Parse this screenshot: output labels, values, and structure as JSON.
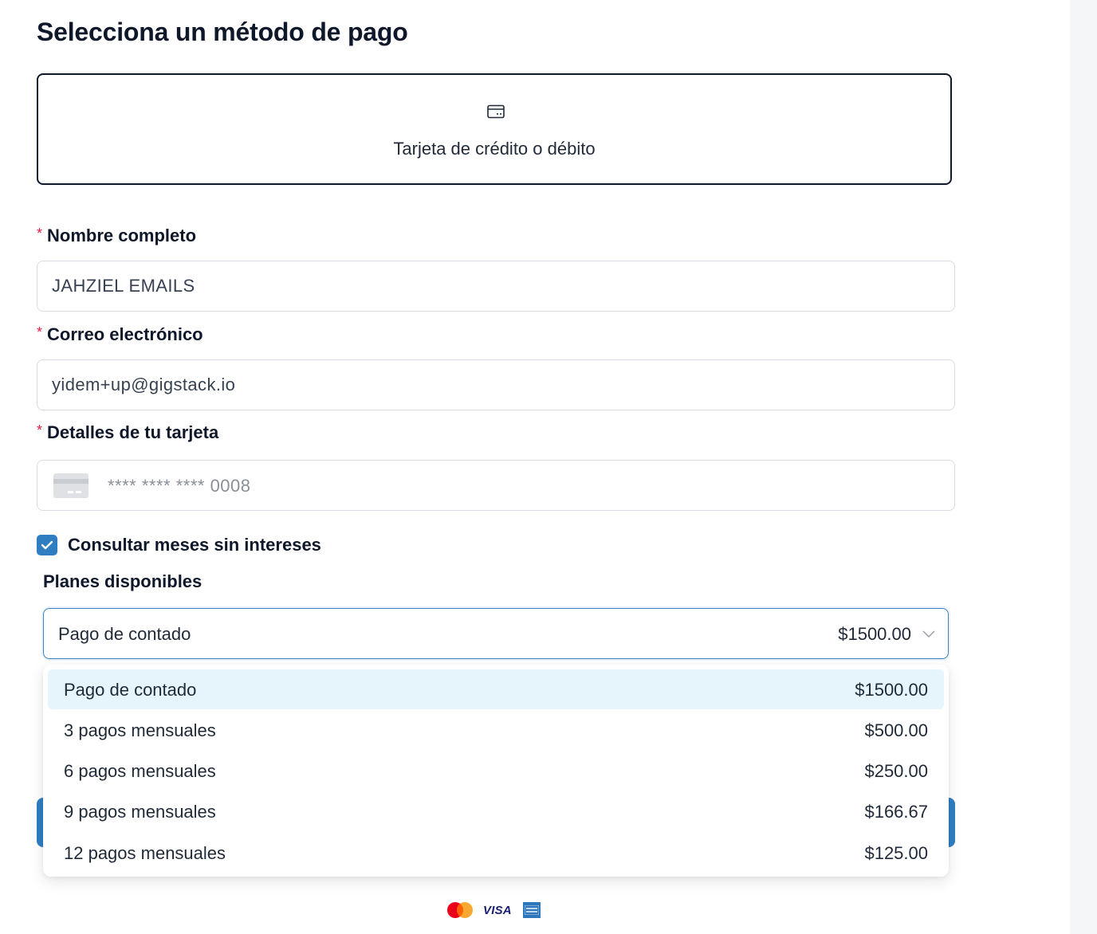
{
  "page": {
    "title": "Selecciona un método de pago"
  },
  "payment_method": {
    "label": "Tarjeta de crédito o débito",
    "icon": "credit-card-icon"
  },
  "form": {
    "required_mark": "*",
    "name": {
      "label": "Nombre completo",
      "value": "JAHZIEL EMAILS"
    },
    "email": {
      "label": "Correo electrónico",
      "value": "yidem+up@gigstack.io"
    },
    "card": {
      "label": "Detalles de tu tarjeta",
      "masked_number": "**** **** **** 0008"
    },
    "msi_checkbox": {
      "label": "Consultar meses sin intereses",
      "checked": true
    },
    "plans": {
      "label": "Planes disponibles",
      "selected_label": "Pago de contado",
      "selected_price": "$1500.00",
      "options": [
        {
          "label": "Pago de contado",
          "price": "$1500.00",
          "selected": true
        },
        {
          "label": "3 pagos mensuales",
          "price": "$500.00",
          "selected": false
        },
        {
          "label": "6 pagos mensuales",
          "price": "$250.00",
          "selected": false
        },
        {
          "label": "9 pagos mensuales",
          "price": "$166.67",
          "selected": false
        },
        {
          "label": "12 pagos mensuales",
          "price": "$125.00",
          "selected": false
        }
      ]
    }
  },
  "brands": {
    "visa": "VISA",
    "icons": [
      "mastercard-icon",
      "visa-icon",
      "amex-icon"
    ]
  },
  "colors": {
    "accent": "#2f7ec1",
    "selected_option_bg": "#e6f4fb",
    "required": "#e11d48",
    "dark_text": "#0f172a"
  }
}
